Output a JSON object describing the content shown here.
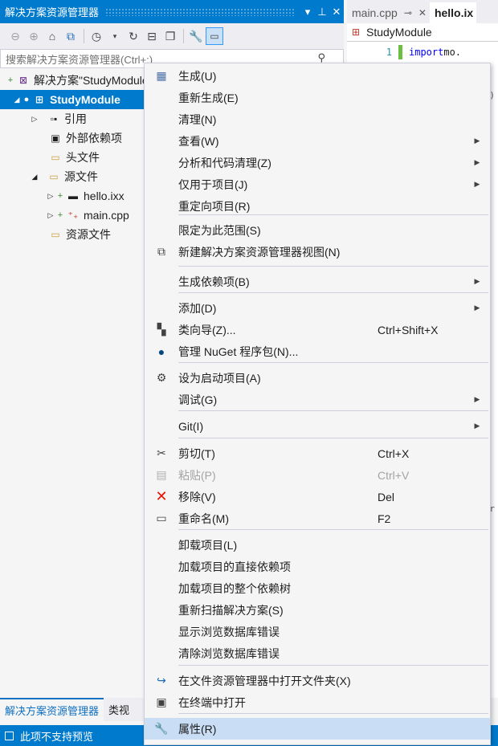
{
  "solution_explorer": {
    "title": "解决方案资源管理器",
    "pin_glyph": "▾ ⊥",
    "close_glyph": "✕",
    "search_placeholder": "搜索解决方案资源管理器(Ctrl+;)",
    "tree": {
      "solution": "解决方案\"StudyModule\"",
      "project": "StudyModule",
      "references": "引用",
      "external_deps": "外部依赖项",
      "header_files": "头文件",
      "source_files": "源文件",
      "file_hello": "hello.ixx",
      "file_main": "main.cpp",
      "resource_files": "资源文件"
    },
    "bottom_tabs": [
      "解决方案资源管理器",
      "类视"
    ]
  },
  "editor": {
    "tabs": [
      {
        "label": "main.cpp",
        "active": false
      },
      {
        "label": "hello.ix",
        "active": true
      }
    ],
    "nav_project": "StudyModule",
    "line_number": "1",
    "code_keyword": "import",
    "code_rest": " mo."
  },
  "status_bar": {
    "text": "此项不支持预览"
  },
  "context_menu": {
    "items": [
      {
        "label": "生成(U)",
        "icon": "build-icon"
      },
      {
        "label": "重新生成(E)"
      },
      {
        "label": "清理(N)"
      },
      {
        "label": "查看(W)",
        "submenu": true
      },
      {
        "label": "分析和代码清理(Z)",
        "submenu": true
      },
      {
        "label": "仅用于项目(J)",
        "submenu": true
      },
      {
        "label": "重定向项目(R)"
      },
      {
        "label": "限定为此范围(S)"
      },
      {
        "label": "新建解决方案资源管理器视图(N)",
        "icon": "new-view-icon"
      },
      {
        "label": "生成依赖项(B)",
        "submenu": true
      },
      {
        "label": "添加(D)",
        "submenu": true
      },
      {
        "label": "类向导(Z)...",
        "shortcut": "Ctrl+Shift+X",
        "icon": "class-wizard-icon"
      },
      {
        "label": "管理 NuGet 程序包(N)...",
        "icon": "nuget-icon"
      },
      {
        "label": "设为启动项目(A)",
        "icon": "gear-icon"
      },
      {
        "label": "调试(G)",
        "submenu": true
      },
      {
        "label": "Git(I)",
        "submenu": true
      },
      {
        "label": "剪切(T)",
        "shortcut": "Ctrl+X",
        "icon": "scissors-icon"
      },
      {
        "label": "粘贴(P)",
        "shortcut": "Ctrl+V",
        "icon": "paste-icon",
        "disabled": true
      },
      {
        "label": "移除(V)",
        "shortcut": "Del",
        "icon": "remove-icon"
      },
      {
        "label": "重命名(M)",
        "shortcut": "F2",
        "icon": "rename-icon"
      },
      {
        "label": "卸载项目(L)"
      },
      {
        "label": "加载项目的直接依赖项"
      },
      {
        "label": "加载项目的整个依赖树"
      },
      {
        "label": "重新扫描解决方案(S)"
      },
      {
        "label": "显示浏览数据库错误"
      },
      {
        "label": "清除浏览数据库错误"
      },
      {
        "label": "在文件资源管理器中打开文件夹(X)",
        "icon": "open-folder-icon"
      },
      {
        "label": "在终端中打开",
        "icon": "terminal-icon"
      },
      {
        "label": "属性(R)",
        "icon": "wrench-icon",
        "highlighted": true
      }
    ]
  },
  "colors": {
    "accent": "#007acc",
    "menu_highlight": "#c9def5",
    "remove_red": "#e51400"
  }
}
